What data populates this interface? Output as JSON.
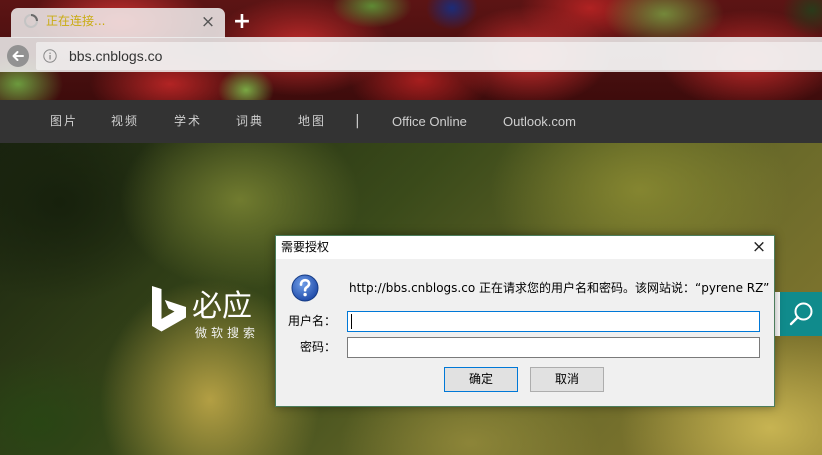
{
  "browser": {
    "tab": {
      "title": "正在连接...",
      "close_glyph": "×",
      "loading_icon": "spinner-icon"
    },
    "new_tab_glyph": "+",
    "toolbar": {
      "back_icon": "back-arrow-icon",
      "info_icon": "info-icon",
      "url": "bbs.cnblogs.co"
    }
  },
  "bing": {
    "nav": {
      "items": [
        {
          "label": "图片"
        },
        {
          "label": "视频"
        },
        {
          "label": "学术"
        },
        {
          "label": "词典"
        },
        {
          "label": "地图"
        }
      ],
      "separator": "|",
      "links": [
        {
          "label": "Office Online"
        },
        {
          "label": "Outlook.com"
        }
      ]
    },
    "logo": {
      "icon": "bing-b-logo-icon",
      "name": "必应",
      "tagline": "微软搜索"
    },
    "search": {
      "value": "",
      "button_icon": "search-icon"
    }
  },
  "dialog": {
    "title": "需要授权",
    "close_glyph": "×",
    "icon": "question-icon",
    "message": "http://bbs.cnblogs.co 正在请求您的用户名和密码。该网站说：“pyrene RZ”",
    "username": {
      "label": "用户名：",
      "value": ""
    },
    "password": {
      "label": "密码：",
      "value": ""
    },
    "ok_label": "确定",
    "cancel_label": "取消"
  },
  "colors": {
    "tab_title": "#c9ac12",
    "nav_bg": "#333333",
    "nav_text": "#cfcfcf",
    "search_button": "#108b8c",
    "dialog_border": "#4c7d5c",
    "focus_blue": "#0078d7"
  }
}
